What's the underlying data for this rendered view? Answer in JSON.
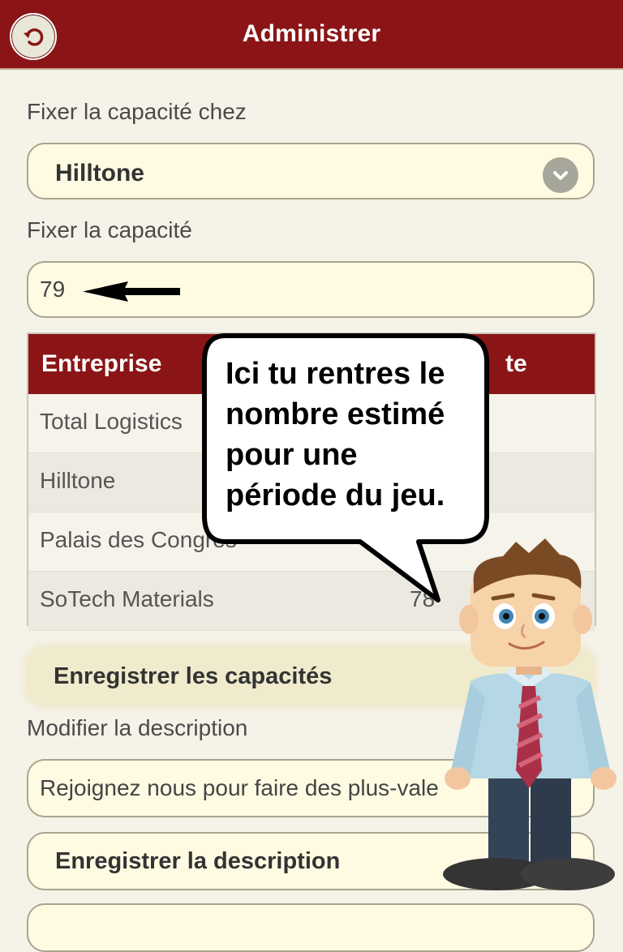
{
  "header": {
    "title": "Administrer"
  },
  "capacity_location": {
    "label": "Fixer la capacité chez",
    "selected": "Hilltone"
  },
  "capacity": {
    "label": "Fixer la capacité",
    "value": "79"
  },
  "table": {
    "headers": [
      "Entreprise",
      "Capacité"
    ],
    "header2_visible": "te",
    "rows": [
      {
        "company": "Total Logistics",
        "capacity": ""
      },
      {
        "company": "Hilltone",
        "capacity": ""
      },
      {
        "company": "Palais des Congres",
        "capacity": ""
      },
      {
        "company": "SoTech Materials",
        "capacity": "78"
      }
    ]
  },
  "save_capacities": {
    "label": "Enregistrer les capacités"
  },
  "description": {
    "label": "Modifier la description",
    "value": "Rejoignez nous pour faire des plus-vale"
  },
  "save_description": {
    "label": "Enregistrer la description"
  },
  "tooltip": {
    "lines": [
      "Ici tu rentres le",
      "nombre estimé",
      "pour une",
      "période du jeu."
    ]
  },
  "colors": {
    "header": "#8b1516",
    "background": "#f5f2e8",
    "field": "#fffbe3"
  },
  "icons": [
    "back-arrow-icon",
    "chevron-down-icon",
    "pointer-arrow-icon",
    "character-mascot"
  ]
}
